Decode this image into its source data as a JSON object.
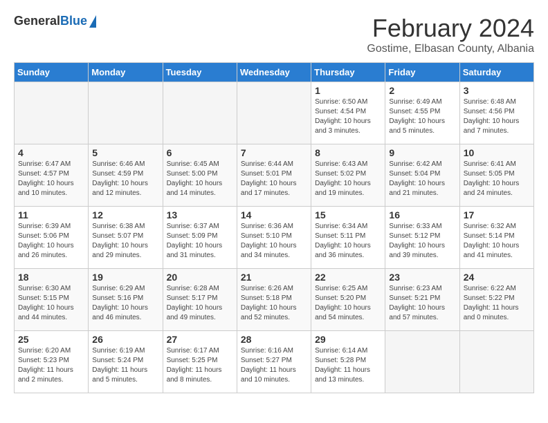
{
  "header": {
    "logo_general": "General",
    "logo_blue": "Blue",
    "month_title": "February 2024",
    "location": "Gostime, Elbasan County, Albania"
  },
  "weekdays": [
    "Sunday",
    "Monday",
    "Tuesday",
    "Wednesday",
    "Thursday",
    "Friday",
    "Saturday"
  ],
  "weeks": [
    [
      {
        "day": "",
        "sunrise": "",
        "sunset": "",
        "daylight": "",
        "empty": true
      },
      {
        "day": "",
        "sunrise": "",
        "sunset": "",
        "daylight": "",
        "empty": true
      },
      {
        "day": "",
        "sunrise": "",
        "sunset": "",
        "daylight": "",
        "empty": true
      },
      {
        "day": "",
        "sunrise": "",
        "sunset": "",
        "daylight": "",
        "empty": true
      },
      {
        "day": "1",
        "sunrise": "Sunrise: 6:50 AM",
        "sunset": "Sunset: 4:54 PM",
        "daylight": "Daylight: 10 hours and 3 minutes.",
        "empty": false
      },
      {
        "day": "2",
        "sunrise": "Sunrise: 6:49 AM",
        "sunset": "Sunset: 4:55 PM",
        "daylight": "Daylight: 10 hours and 5 minutes.",
        "empty": false
      },
      {
        "day": "3",
        "sunrise": "Sunrise: 6:48 AM",
        "sunset": "Sunset: 4:56 PM",
        "daylight": "Daylight: 10 hours and 7 minutes.",
        "empty": false
      }
    ],
    [
      {
        "day": "4",
        "sunrise": "Sunrise: 6:47 AM",
        "sunset": "Sunset: 4:57 PM",
        "daylight": "Daylight: 10 hours and 10 minutes.",
        "empty": false
      },
      {
        "day": "5",
        "sunrise": "Sunrise: 6:46 AM",
        "sunset": "Sunset: 4:59 PM",
        "daylight": "Daylight: 10 hours and 12 minutes.",
        "empty": false
      },
      {
        "day": "6",
        "sunrise": "Sunrise: 6:45 AM",
        "sunset": "Sunset: 5:00 PM",
        "daylight": "Daylight: 10 hours and 14 minutes.",
        "empty": false
      },
      {
        "day": "7",
        "sunrise": "Sunrise: 6:44 AM",
        "sunset": "Sunset: 5:01 PM",
        "daylight": "Daylight: 10 hours and 17 minutes.",
        "empty": false
      },
      {
        "day": "8",
        "sunrise": "Sunrise: 6:43 AM",
        "sunset": "Sunset: 5:02 PM",
        "daylight": "Daylight: 10 hours and 19 minutes.",
        "empty": false
      },
      {
        "day": "9",
        "sunrise": "Sunrise: 6:42 AM",
        "sunset": "Sunset: 5:04 PM",
        "daylight": "Daylight: 10 hours and 21 minutes.",
        "empty": false
      },
      {
        "day": "10",
        "sunrise": "Sunrise: 6:41 AM",
        "sunset": "Sunset: 5:05 PM",
        "daylight": "Daylight: 10 hours and 24 minutes.",
        "empty": false
      }
    ],
    [
      {
        "day": "11",
        "sunrise": "Sunrise: 6:39 AM",
        "sunset": "Sunset: 5:06 PM",
        "daylight": "Daylight: 10 hours and 26 minutes.",
        "empty": false
      },
      {
        "day": "12",
        "sunrise": "Sunrise: 6:38 AM",
        "sunset": "Sunset: 5:07 PM",
        "daylight": "Daylight: 10 hours and 29 minutes.",
        "empty": false
      },
      {
        "day": "13",
        "sunrise": "Sunrise: 6:37 AM",
        "sunset": "Sunset: 5:09 PM",
        "daylight": "Daylight: 10 hours and 31 minutes.",
        "empty": false
      },
      {
        "day": "14",
        "sunrise": "Sunrise: 6:36 AM",
        "sunset": "Sunset: 5:10 PM",
        "daylight": "Daylight: 10 hours and 34 minutes.",
        "empty": false
      },
      {
        "day": "15",
        "sunrise": "Sunrise: 6:34 AM",
        "sunset": "Sunset: 5:11 PM",
        "daylight": "Daylight: 10 hours and 36 minutes.",
        "empty": false
      },
      {
        "day": "16",
        "sunrise": "Sunrise: 6:33 AM",
        "sunset": "Sunset: 5:12 PM",
        "daylight": "Daylight: 10 hours and 39 minutes.",
        "empty": false
      },
      {
        "day": "17",
        "sunrise": "Sunrise: 6:32 AM",
        "sunset": "Sunset: 5:14 PM",
        "daylight": "Daylight: 10 hours and 41 minutes.",
        "empty": false
      }
    ],
    [
      {
        "day": "18",
        "sunrise": "Sunrise: 6:30 AM",
        "sunset": "Sunset: 5:15 PM",
        "daylight": "Daylight: 10 hours and 44 minutes.",
        "empty": false
      },
      {
        "day": "19",
        "sunrise": "Sunrise: 6:29 AM",
        "sunset": "Sunset: 5:16 PM",
        "daylight": "Daylight: 10 hours and 46 minutes.",
        "empty": false
      },
      {
        "day": "20",
        "sunrise": "Sunrise: 6:28 AM",
        "sunset": "Sunset: 5:17 PM",
        "daylight": "Daylight: 10 hours and 49 minutes.",
        "empty": false
      },
      {
        "day": "21",
        "sunrise": "Sunrise: 6:26 AM",
        "sunset": "Sunset: 5:18 PM",
        "daylight": "Daylight: 10 hours and 52 minutes.",
        "empty": false
      },
      {
        "day": "22",
        "sunrise": "Sunrise: 6:25 AM",
        "sunset": "Sunset: 5:20 PM",
        "daylight": "Daylight: 10 hours and 54 minutes.",
        "empty": false
      },
      {
        "day": "23",
        "sunrise": "Sunrise: 6:23 AM",
        "sunset": "Sunset: 5:21 PM",
        "daylight": "Daylight: 10 hours and 57 minutes.",
        "empty": false
      },
      {
        "day": "24",
        "sunrise": "Sunrise: 6:22 AM",
        "sunset": "Sunset: 5:22 PM",
        "daylight": "Daylight: 11 hours and 0 minutes.",
        "empty": false
      }
    ],
    [
      {
        "day": "25",
        "sunrise": "Sunrise: 6:20 AM",
        "sunset": "Sunset: 5:23 PM",
        "daylight": "Daylight: 11 hours and 2 minutes.",
        "empty": false
      },
      {
        "day": "26",
        "sunrise": "Sunrise: 6:19 AM",
        "sunset": "Sunset: 5:24 PM",
        "daylight": "Daylight: 11 hours and 5 minutes.",
        "empty": false
      },
      {
        "day": "27",
        "sunrise": "Sunrise: 6:17 AM",
        "sunset": "Sunset: 5:25 PM",
        "daylight": "Daylight: 11 hours and 8 minutes.",
        "empty": false
      },
      {
        "day": "28",
        "sunrise": "Sunrise: 6:16 AM",
        "sunset": "Sunset: 5:27 PM",
        "daylight": "Daylight: 11 hours and 10 minutes.",
        "empty": false
      },
      {
        "day": "29",
        "sunrise": "Sunrise: 6:14 AM",
        "sunset": "Sunset: 5:28 PM",
        "daylight": "Daylight: 11 hours and 13 minutes.",
        "empty": false
      },
      {
        "day": "",
        "sunrise": "",
        "sunset": "",
        "daylight": "",
        "empty": true
      },
      {
        "day": "",
        "sunrise": "",
        "sunset": "",
        "daylight": "",
        "empty": true
      }
    ]
  ]
}
